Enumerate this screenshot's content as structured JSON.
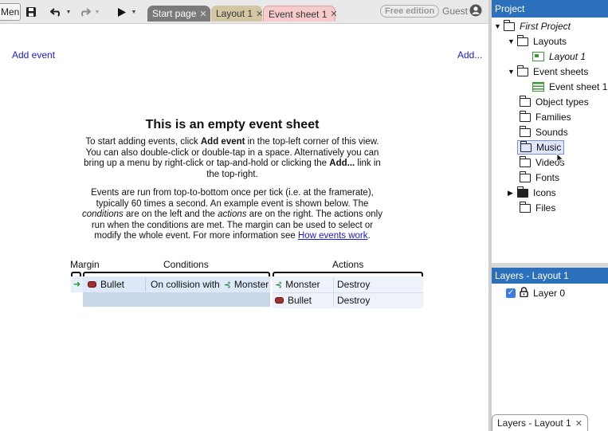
{
  "toolbar": {
    "menu_label": "Menu",
    "tabs": [
      {
        "label": "Start page"
      },
      {
        "label": "Layout 1"
      },
      {
        "label": "Event sheet 1"
      }
    ],
    "edition_badge": "Free edition",
    "user_label": "Guest"
  },
  "sheet": {
    "add_event_link": "Add event",
    "add_more_link": "Add...",
    "empty_title": "This is an empty event sheet",
    "para1": {
      "t1": "To start adding events, click ",
      "b1": "Add event",
      "t2": " in the top-left corner of this view. You can also double-click or double-tap in a space. Alternatively you can bring up a menu by right-click or tap-and-hold or clicking the ",
      "b2": "Add...",
      "t3": " link in the top-right."
    },
    "para2": {
      "t1": "Events are run from top-to-bottom once per tick (i.e. at the framerate), typically 60 times a second. An example event is shown below. The ",
      "i1": "conditions",
      "t2": " are on the left and the ",
      "i2": "actions",
      "t3": " are on the right. The actions only run when the conditions are met. The margin can be used to select or modify the whole event. For more information see ",
      "link": "How events work",
      "t4": "."
    },
    "example": {
      "headers": {
        "margin": "Margin",
        "conditions": "Conditions",
        "actions": "Actions"
      },
      "condition": {
        "object": "Bullet",
        "text": "On collision with",
        "target": "Monster"
      },
      "actions": [
        {
          "object": "Monster",
          "action": "Destroy"
        },
        {
          "object": "Bullet",
          "action": "Destroy"
        }
      ]
    }
  },
  "project_panel": {
    "title": "Project",
    "items": [
      {
        "label": "First Project"
      },
      {
        "label": "Layouts"
      },
      {
        "label": "Layout 1"
      },
      {
        "label": "Event sheets"
      },
      {
        "label": "Event sheet 1"
      },
      {
        "label": "Object types"
      },
      {
        "label": "Families"
      },
      {
        "label": "Sounds"
      },
      {
        "label": "Music"
      },
      {
        "label": "Videos"
      },
      {
        "label": "Fonts"
      },
      {
        "label": "Icons"
      },
      {
        "label": "Files"
      }
    ]
  },
  "layers_panel": {
    "title": "Layers - Layout 1",
    "layers": [
      {
        "label": "Layer 0",
        "visible": true,
        "locked": true
      }
    ],
    "bottom_tab": "Layers - Layout 1"
  }
}
